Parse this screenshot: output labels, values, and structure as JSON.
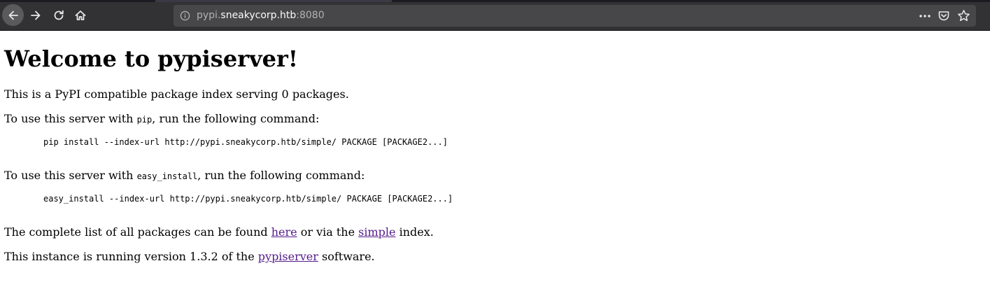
{
  "browser": {
    "url_prefix": "pypi.",
    "url_domain": "sneakycorp.htb",
    "url_port": ":8080",
    "icons": {
      "back": "back-arrow-icon",
      "forward": "forward-arrow-icon",
      "reload": "reload-icon",
      "home": "home-icon",
      "info": "info-icon",
      "page_actions": "more-horizontal-icon",
      "pocket": "pocket-icon",
      "bookmark": "star-icon"
    }
  },
  "page": {
    "heading": "Welcome to pypiserver!",
    "intro": "This is a PyPI compatible package index serving 0 packages.",
    "pip_section": {
      "text_before": "To use this server with ",
      "tool": "pip",
      "text_after": ", run the following command:",
      "command": "pip install --index-url http://pypi.sneakycorp.htb/simple/ PACKAGE [PACKAGE2...]"
    },
    "easy_install_section": {
      "text_before": "To use this server with ",
      "tool": "easy_install",
      "text_after": ", run the following command:",
      "command": "easy_install --index-url http://pypi.sneakycorp.htb/simple/ PACKAGE [PACKAGE2...]"
    },
    "packages_line": {
      "text_before": "The complete list of all packages can be found ",
      "link_here": "here",
      "text_middle": " or via the ",
      "link_simple": "simple",
      "text_after": " index."
    },
    "version_line": {
      "text_before": "This instance is running version 1.3.2 of the ",
      "link_pypiserver": "pypiserver",
      "text_after": " software."
    }
  }
}
